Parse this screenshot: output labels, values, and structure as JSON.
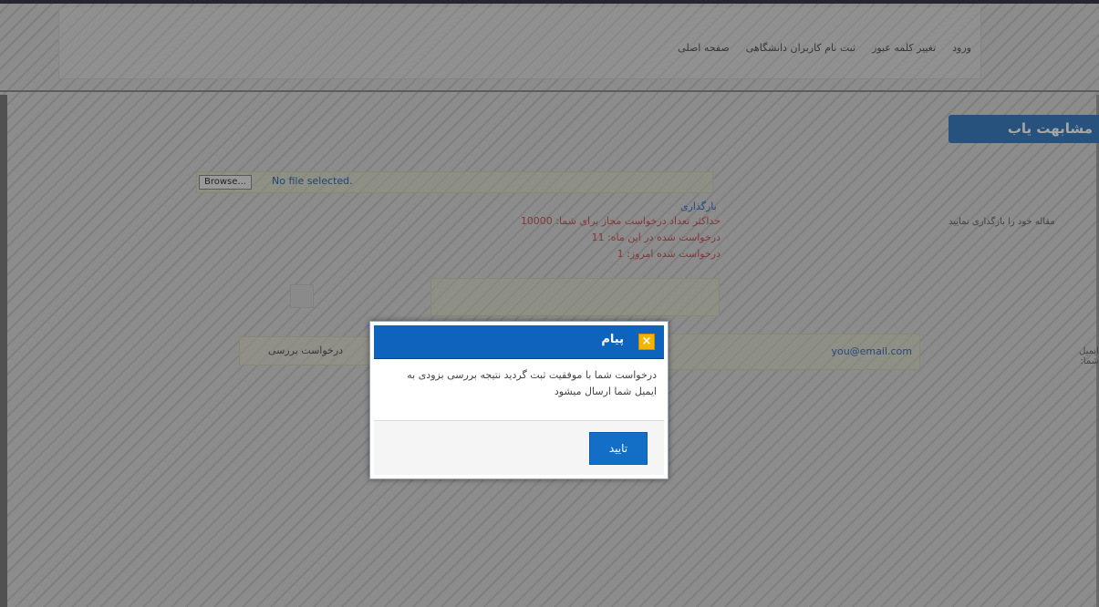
{
  "nav": {
    "items": [
      "صفحه اصلی",
      "ثبت نام کاربران دانشگاهی",
      "تغییر کلمه عبور",
      "ورود"
    ]
  },
  "section": {
    "title": "مشابهت یاب"
  },
  "upload": {
    "browse_label": "Browse...",
    "file_status": "No file selected.",
    "side_label": "مقاله خود را بارگذاری نمایید",
    "upload_link": "بارگذاری",
    "limit_line": "حداکثر تعداد درخواست مجاز برای شما: 10000",
    "month_line": "درخواست شده در این ماه: 11",
    "today_line": "درخواست شده امروز: 1"
  },
  "email": {
    "label": "ایمیل شما:",
    "value": "you@email.com"
  },
  "request": {
    "button_label": "درخواست بررسی"
  },
  "dialog": {
    "title": "پیام",
    "message": "درخواست شما با موفقیت ثبت گردید نتیجه بررسی بزودی به ایمیل شما ارسال میشود",
    "ok_label": "تایید",
    "close_icon_glyph": "×"
  },
  "colors": {
    "header_blue": "#0e63bd",
    "tag_blue": "#3d7fc0",
    "close_yellow": "#f4b400",
    "red_text": "#cc5555",
    "link_blue": "#3a6fc5"
  }
}
